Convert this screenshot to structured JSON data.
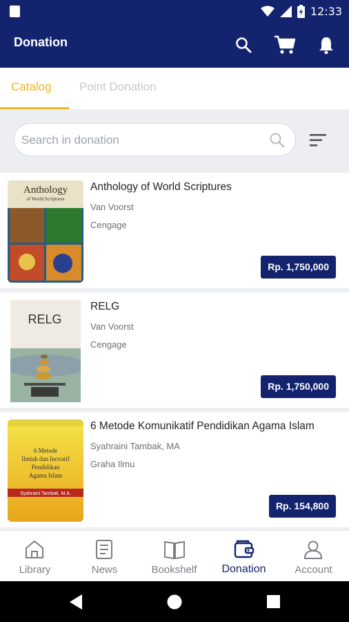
{
  "status_bar": {
    "time": "12:33"
  },
  "app_bar": {
    "title": "Donation"
  },
  "tabs": [
    {
      "label": "Catalog",
      "active": true
    },
    {
      "label": "Point Donation",
      "active": false
    }
  ],
  "search": {
    "placeholder": "Search in donation"
  },
  "books": [
    {
      "title": "Anthology of World Scriptures",
      "author": "Van Voorst",
      "publisher": "Cengage",
      "price": "Rp. 1,750,000",
      "cover_text": "Anthology",
      "cover_subtext": "of World Scriptures"
    },
    {
      "title": "RELG",
      "author": "Van Voorst",
      "publisher": "Cengage",
      "price": "Rp. 1,750,000",
      "cover_text": "RELG"
    },
    {
      "title": "6 Metode Komunikatif Pendidikan Agama Islam",
      "author": "Syahraini Tambak, MA",
      "publisher": "Graha Ilmu",
      "price": "Rp. 154,800",
      "cover_text": "6 Metode Ilmiah dan Inovatif Pendidikan Agama Islam",
      "cover_subtext": "Syahraini Tambak, M.A."
    }
  ],
  "bottom_nav": [
    {
      "label": "Library",
      "icon": "home-icon"
    },
    {
      "label": "News",
      "icon": "news-icon"
    },
    {
      "label": "Bookshelf",
      "icon": "book-icon"
    },
    {
      "label": "Donation",
      "icon": "donation-icon",
      "active": true
    },
    {
      "label": "Account",
      "icon": "account-icon"
    }
  ],
  "colors": {
    "primary": "#13236e",
    "accent": "#f2b51c"
  }
}
